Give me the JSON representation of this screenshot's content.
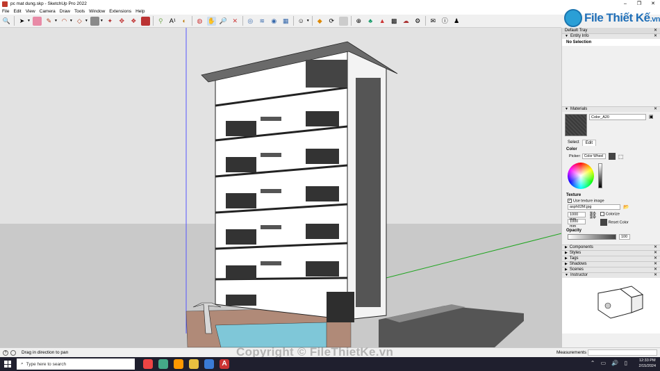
{
  "window": {
    "title": "pc mat dung.skp - SketchUp Pro 2022",
    "controls": [
      "–",
      "❐",
      "✕"
    ]
  },
  "menu": [
    "File",
    "Edit",
    "View",
    "Camera",
    "Draw",
    "Tools",
    "Window",
    "Extensions",
    "Help"
  ],
  "logo": {
    "text": "File Thiết Kế",
    "suffix": ".vn"
  },
  "tray": {
    "title": "Default Tray",
    "entity_info": {
      "title": "Entity Info",
      "status": "No Selection"
    },
    "materials": {
      "title": "Materials",
      "name": "Color_A20",
      "tabs": [
        "Select",
        "Edit"
      ],
      "color_label": "Color",
      "picker_label": "Picker:",
      "picker_value": "Color Wheel",
      "texture_label": "Texture",
      "use_texture": "Use texture image",
      "texture_file": "asph02M.jpg",
      "width": "1000 mm",
      "height": "1000 mm",
      "colorize": "Colorize",
      "reset_color": "Reset Color",
      "opacity_label": "Opacity",
      "opacity_value": "100"
    },
    "panels": [
      "Components",
      "Styles",
      "Tags",
      "Shadows",
      "Scenes",
      "Instructor"
    ]
  },
  "status": {
    "message": "Drag in direction to pan",
    "measurements_label": "Measurements"
  },
  "watermark": "Copyright © FileThietKe.vn",
  "taskbar": {
    "search_placeholder": "Type here to search",
    "time": "12:33 PM",
    "date": "2/15/2024"
  },
  "colors": {
    "axis_blue": "#5555ff",
    "axis_green": "#1fa51f",
    "ground": "#c9c9c9",
    "sky": "#e2e2e2"
  }
}
